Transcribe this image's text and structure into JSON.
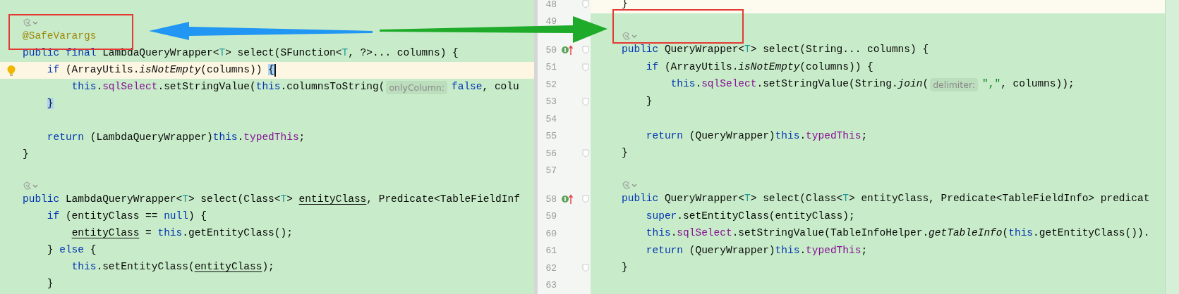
{
  "left_editor": {
    "lines": [
      {
        "kind": "blank",
        "current": false
      },
      {
        "kind": "hint",
        "current": false
      },
      {
        "kind": "code",
        "current": false,
        "tokens": [
          {
            "kind": "annotation",
            "text": "@SafeVarargs"
          }
        ]
      },
      {
        "kind": "code",
        "current": false,
        "tokens": [
          {
            "kind": "keyword",
            "text": "public final "
          },
          {
            "kind": "plain",
            "text": "LambdaQueryWrapper<"
          },
          {
            "kind": "type",
            "text": "T"
          },
          {
            "kind": "plain",
            "text": "> select(SFunction<"
          },
          {
            "kind": "type",
            "text": "T"
          },
          {
            "kind": "plain",
            "text": ", ?>... columns) {"
          }
        ]
      },
      {
        "kind": "code",
        "current": true,
        "gutter": {
          "kind": "lightbulb"
        },
        "caret": true,
        "tokens": [
          {
            "kind": "keyword",
            "text": "    if "
          },
          {
            "kind": "plain",
            "text": "(ArrayUtils."
          },
          {
            "kind": "static",
            "text": "isNotEmpty"
          },
          {
            "kind": "plain",
            "text": "(columns)) "
          },
          {
            "kind": "brace",
            "text": "{"
          }
        ]
      },
      {
        "kind": "code",
        "current": false,
        "tokens": [
          {
            "kind": "keyword",
            "text": "        this"
          },
          {
            "kind": "plain",
            "text": "."
          },
          {
            "kind": "field",
            "text": "sqlSelect"
          },
          {
            "kind": "plain",
            "text": ".setStringValue("
          },
          {
            "kind": "keyword",
            "text": "this"
          },
          {
            "kind": "plain",
            "text": ".columnsToString("
          },
          {
            "kind": "hint",
            "text": "onlyColumn:"
          },
          {
            "kind": "keyword",
            "text": "false"
          },
          {
            "kind": "plain",
            "text": ", colu"
          }
        ]
      },
      {
        "kind": "code",
        "current": false,
        "tokens": [
          {
            "kind": "brace",
            "text": "    }"
          }
        ]
      },
      {
        "kind": "blank",
        "current": false
      },
      {
        "kind": "code",
        "current": false,
        "tokens": [
          {
            "kind": "keyword",
            "text": "    return "
          },
          {
            "kind": "plain",
            "text": "(LambdaQueryWrapper)"
          },
          {
            "kind": "keyword",
            "text": "this"
          },
          {
            "kind": "plain",
            "text": "."
          },
          {
            "kind": "field",
            "text": "typedThis"
          },
          {
            "kind": "plain",
            "text": ";"
          }
        ]
      },
      {
        "kind": "code",
        "current": false,
        "tokens": [
          {
            "kind": "plain",
            "text": "}"
          }
        ]
      },
      {
        "kind": "blank",
        "current": false
      },
      {
        "kind": "hint",
        "current": false
      },
      {
        "kind": "code",
        "current": false,
        "tokens": [
          {
            "kind": "keyword",
            "text": "public "
          },
          {
            "kind": "plain",
            "text": "LambdaQueryWrapper<"
          },
          {
            "kind": "type",
            "text": "T"
          },
          {
            "kind": "plain",
            "text": "> select(Class<"
          },
          {
            "kind": "type",
            "text": "T"
          },
          {
            "kind": "plain",
            "text": "> "
          },
          {
            "kind": "reassigned",
            "text": "entityClass"
          },
          {
            "kind": "plain",
            "text": ", Predicate<TableFieldInf"
          }
        ]
      },
      {
        "kind": "code",
        "current": false,
        "tokens": [
          {
            "kind": "keyword",
            "text": "    if "
          },
          {
            "kind": "plain",
            "text": "(entityClass == "
          },
          {
            "kind": "keyword",
            "text": "null"
          },
          {
            "kind": "plain",
            "text": ") {"
          }
        ]
      },
      {
        "kind": "code",
        "current": false,
        "tokens": [
          {
            "kind": "reassigned",
            "text": "        entityClass"
          },
          {
            "kind": "plain",
            "text": " = "
          },
          {
            "kind": "keyword",
            "text": "this"
          },
          {
            "kind": "plain",
            "text": ".getEntityClass();"
          }
        ]
      },
      {
        "kind": "code",
        "current": false,
        "tokens": [
          {
            "kind": "plain",
            "text": "    } "
          },
          {
            "kind": "keyword",
            "text": "else "
          },
          {
            "kind": "plain",
            "text": "{"
          }
        ]
      },
      {
        "kind": "code",
        "current": false,
        "tokens": [
          {
            "kind": "keyword",
            "text": "        this"
          },
          {
            "kind": "plain",
            "text": ".setEntityClass("
          },
          {
            "kind": "reassigned",
            "text": "entityClass"
          },
          {
            "kind": "plain",
            "text": ");"
          }
        ]
      },
      {
        "kind": "code",
        "current": false,
        "tokens": [
          {
            "kind": "plain",
            "text": "    }"
          }
        ]
      }
    ]
  },
  "right_editor": {
    "lines": [
      {
        "kind": "code",
        "number": "48",
        "changed": false,
        "fold": true,
        "tokens": [
          {
            "kind": "plain",
            "text": "}"
          }
        ]
      },
      {
        "kind": "blank",
        "number": "49",
        "changed": true,
        "fold": false
      },
      {
        "kind": "hint",
        "changed": true,
        "fold": false
      },
      {
        "kind": "code",
        "number": "50",
        "changed": true,
        "fold": true,
        "gutter": {
          "kind": "override"
        },
        "tokens": [
          {
            "kind": "keyword",
            "text": "public "
          },
          {
            "kind": "plain",
            "text": "QueryWrapper<"
          },
          {
            "kind": "type",
            "text": "T"
          },
          {
            "kind": "plain",
            "text": "> select(String... columns) {"
          }
        ]
      },
      {
        "kind": "code",
        "number": "51",
        "changed": true,
        "fold": true,
        "tokens": [
          {
            "kind": "keyword",
            "text": "    if "
          },
          {
            "kind": "plain",
            "text": "(ArrayUtils."
          },
          {
            "kind": "static",
            "text": "isNotEmpty"
          },
          {
            "kind": "plain",
            "text": "(columns)) {"
          }
        ]
      },
      {
        "kind": "code",
        "number": "52",
        "changed": true,
        "fold": false,
        "tokens": [
          {
            "kind": "keyword",
            "text": "        this"
          },
          {
            "kind": "plain",
            "text": "."
          },
          {
            "kind": "field",
            "text": "sqlSelect"
          },
          {
            "kind": "plain",
            "text": ".setStringValue(String."
          },
          {
            "kind": "static",
            "text": "join"
          },
          {
            "kind": "plain",
            "text": "("
          },
          {
            "kind": "hint",
            "text": "delimiter:"
          },
          {
            "kind": "string",
            "text": "\",\""
          },
          {
            "kind": "plain",
            "text": ", columns));"
          }
        ]
      },
      {
        "kind": "code",
        "number": "53",
        "changed": true,
        "fold": true,
        "tokens": [
          {
            "kind": "plain",
            "text": "    }"
          }
        ]
      },
      {
        "kind": "blank",
        "number": "54",
        "changed": true,
        "fold": false
      },
      {
        "kind": "code",
        "number": "55",
        "changed": true,
        "fold": false,
        "tokens": [
          {
            "kind": "keyword",
            "text": "    return "
          },
          {
            "kind": "plain",
            "text": "(QueryWrapper)"
          },
          {
            "kind": "keyword",
            "text": "this"
          },
          {
            "kind": "plain",
            "text": "."
          },
          {
            "kind": "field",
            "text": "typedThis"
          },
          {
            "kind": "plain",
            "text": ";"
          }
        ]
      },
      {
        "kind": "code",
        "number": "56",
        "changed": true,
        "fold": true,
        "tokens": [
          {
            "kind": "plain",
            "text": "}"
          }
        ]
      },
      {
        "kind": "blank",
        "number": "57",
        "changed": true,
        "fold": false
      },
      {
        "kind": "hint",
        "changed": true,
        "fold": false
      },
      {
        "kind": "code",
        "number": "58",
        "changed": true,
        "fold": true,
        "gutter": {
          "kind": "override"
        },
        "tokens": [
          {
            "kind": "keyword",
            "text": "public "
          },
          {
            "kind": "plain",
            "text": "QueryWrapper<"
          },
          {
            "kind": "type",
            "text": "T"
          },
          {
            "kind": "plain",
            "text": "> select(Class<"
          },
          {
            "kind": "type",
            "text": "T"
          },
          {
            "kind": "plain",
            "text": "> entityClass, Predicate<TableFieldInfo> predicat"
          }
        ]
      },
      {
        "kind": "code",
        "number": "59",
        "changed": true,
        "fold": false,
        "tokens": [
          {
            "kind": "keyword",
            "text": "    super"
          },
          {
            "kind": "plain",
            "text": ".setEntityClass(entityClass);"
          }
        ]
      },
      {
        "kind": "code",
        "number": "60",
        "changed": true,
        "fold": false,
        "tokens": [
          {
            "kind": "keyword",
            "text": "    this"
          },
          {
            "kind": "plain",
            "text": "."
          },
          {
            "kind": "field",
            "text": "sqlSelect"
          },
          {
            "kind": "plain",
            "text": ".setStringValue(TableInfoHelper."
          },
          {
            "kind": "static",
            "text": "getTableInfo"
          },
          {
            "kind": "plain",
            "text": "("
          },
          {
            "kind": "keyword",
            "text": "this"
          },
          {
            "kind": "plain",
            "text": ".getEntityClass())."
          }
        ]
      },
      {
        "kind": "code",
        "number": "61",
        "changed": true,
        "fold": false,
        "tokens": [
          {
            "kind": "keyword",
            "text": "    return "
          },
          {
            "kind": "plain",
            "text": "(QueryWrapper)"
          },
          {
            "kind": "keyword",
            "text": "this"
          },
          {
            "kind": "plain",
            "text": "."
          },
          {
            "kind": "field",
            "text": "typedThis"
          },
          {
            "kind": "plain",
            "text": ";"
          }
        ]
      },
      {
        "kind": "code",
        "number": "62",
        "changed": true,
        "fold": true,
        "tokens": [
          {
            "kind": "plain",
            "text": "}"
          }
        ]
      },
      {
        "kind": "blank",
        "number": "63",
        "changed": true,
        "fold": false
      }
    ]
  },
  "annotations": [
    {
      "kind": "box"
    },
    {
      "kind": "arrow",
      "color": "#2196f3"
    },
    {
      "kind": "arrow",
      "color": "#1fab2a"
    },
    {
      "kind": "box"
    }
  ]
}
